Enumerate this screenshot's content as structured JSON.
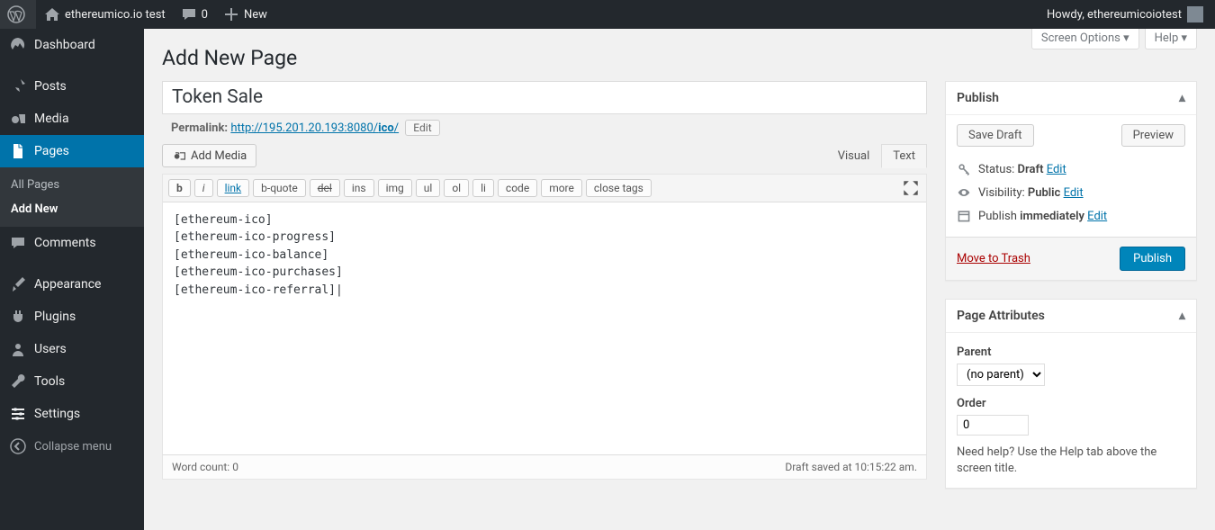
{
  "adminbar": {
    "site_name": "ethereumico.io test",
    "comments_count": "0",
    "new_label": "New",
    "howdy": "Howdy, ethereumicoiotest"
  },
  "menu": {
    "dashboard": "Dashboard",
    "posts": "Posts",
    "media": "Media",
    "pages": "Pages",
    "pages_sub_all": "All Pages",
    "pages_sub_add": "Add New",
    "comments": "Comments",
    "appearance": "Appearance",
    "plugins": "Plugins",
    "users": "Users",
    "tools": "Tools",
    "settings": "Settings",
    "collapse": "Collapse menu"
  },
  "screen": {
    "options": "Screen Options",
    "help": "Help"
  },
  "page": {
    "heading": "Add New Page",
    "title_value": "Token Sale",
    "permalink_label": "Permalink:",
    "permalink_base": "http://195.201.20.193:8080/",
    "permalink_slug": "ico",
    "permalink_trail": "/",
    "edit_slug": "Edit",
    "add_media": "Add Media",
    "tab_visual": "Visual",
    "tab_text": "Text",
    "content": "[ethereum-ico]\n[ethereum-ico-progress]\n[ethereum-ico-balance]\n[ethereum-ico-purchases]\n[ethereum-ico-referral]|",
    "wordcount_label": "Word count: ",
    "wordcount_value": "0",
    "saved_msg": "Draft saved at 10:15:22 am."
  },
  "quicktags": {
    "b": "b",
    "i": "i",
    "link": "link",
    "bquote": "b-quote",
    "del": "del",
    "ins": "ins",
    "img": "img",
    "ul": "ul",
    "ol": "ol",
    "li": "li",
    "code": "code",
    "more": "more",
    "close": "close tags"
  },
  "publish": {
    "box_title": "Publish",
    "save_draft": "Save Draft",
    "preview": "Preview",
    "status_label": "Status: ",
    "status_value": "Draft",
    "visibility_label": "Visibility: ",
    "visibility_value": "Public",
    "publish_label": "Publish ",
    "publish_value": "immediately",
    "edit": "Edit",
    "trash": "Move to Trash",
    "publish_btn": "Publish"
  },
  "attrs": {
    "box_title": "Page Attributes",
    "parent_label": "Parent",
    "parent_value": "(no parent)",
    "order_label": "Order",
    "order_value": "0",
    "help": "Need help? Use the Help tab above the screen title."
  }
}
